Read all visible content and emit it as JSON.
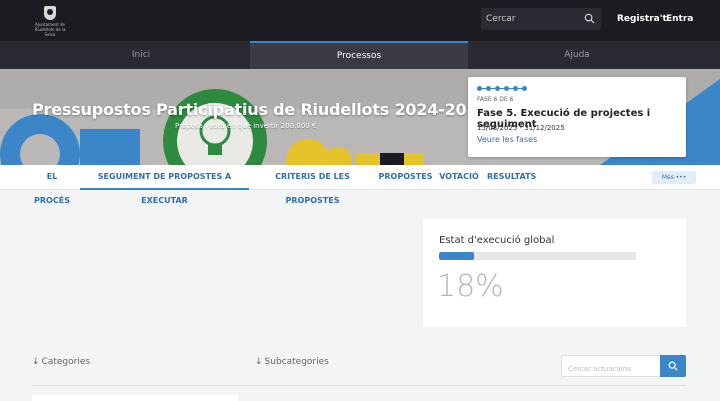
{
  "header": {
    "logo_line1": "Ajuntament de",
    "logo_line2": "Riudellots de la Selva",
    "search_placeholder": "Cercar",
    "register_label": "Registra't",
    "login_label": "Entra"
  },
  "main_nav": [
    {
      "label": "Inici"
    },
    {
      "label": "Processos"
    },
    {
      "label": "Ajuda"
    }
  ],
  "hero": {
    "title": "Pressupostos Participatius de Riudellots 2024-2025",
    "subtitle": "Proposa i vota en què invertir 200.000 €"
  },
  "phase": {
    "step_count": "FASE 6 DE 6",
    "name": "Fase 5. Execució de projectes i seguiment",
    "dates": "15/03/2025 - 31/12/2025",
    "link_label": "Veure les fases",
    "total_steps": 6
  },
  "sub_nav": [
    {
      "label": "EL PROCÉS"
    },
    {
      "label": "SEGUIMENT DE PROPOSTES A EXECUTAR"
    },
    {
      "label": "CRITERIS DE LES PROPOSTES"
    },
    {
      "label": "PROPOSTES"
    },
    {
      "label": "VOTACIÓ"
    },
    {
      "label": "RESULTATS"
    }
  ],
  "more_label": "Més •••",
  "execution": {
    "title": "Estat d'execució global",
    "percent_label": "18%",
    "percent": 18
  },
  "filters": {
    "categories_label": "Categories",
    "subcategories_label": "Subcategories",
    "search_placeholder": "Cercar actuacions"
  },
  "colors": {
    "accent": "#3b86c9",
    "link": "#2f6fb3",
    "topbar": "#1c1b22",
    "nav": "#2a2a33"
  }
}
